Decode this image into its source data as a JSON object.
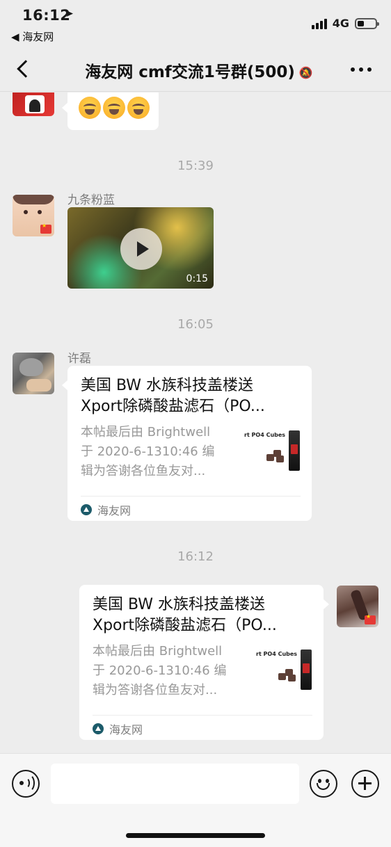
{
  "status_bar": {
    "time": "16:12",
    "location_icon": "location-arrow-icon",
    "back_app": "◀ 海友网",
    "network": "4G"
  },
  "nav": {
    "title": "海友网 cmf交流1号群(500)",
    "mute_icon": "bell-slash-icon",
    "more_icon": "ellipsis-icon"
  },
  "messages": [
    {
      "type": "emoji",
      "side": "left",
      "emoji_count": 3,
      "emoji_icon": "rolling-laughing-emoji"
    },
    {
      "type": "timestamp",
      "text": "15:39"
    },
    {
      "type": "video",
      "side": "left",
      "sender": "九条粉蓝",
      "duration": "0:15"
    },
    {
      "type": "timestamp",
      "text": "16:05"
    },
    {
      "type": "link",
      "side": "left",
      "sender": "许磊",
      "title": "美国 BW 水族科技盖楼送 Xport除磷酸盐滤石（PO...",
      "desc_lines": [
        "本帖最后由 Brightwell",
        "于 2020-6-1310:46 编",
        "辑为答谢各位鱼友对..."
      ],
      "thumb_text": "rt PO4 Cubes",
      "source": "海友网"
    },
    {
      "type": "timestamp",
      "text": "16:12"
    },
    {
      "type": "link",
      "side": "right",
      "title": "美国 BW 水族科技盖楼送 Xport除磷酸盐滤石（PO...",
      "desc_lines": [
        "本帖最后由 Brightwell",
        "于 2020-6-1310:46 编",
        "辑为答谢各位鱼友对..."
      ],
      "thumb_text": "rt PO4 Cubes",
      "source": "海友网"
    }
  ],
  "input_bar": {
    "voice_icon": "voice-icon",
    "input_value": "",
    "emoji_icon": "smiley-icon",
    "plus_icon": "plus-icon"
  }
}
